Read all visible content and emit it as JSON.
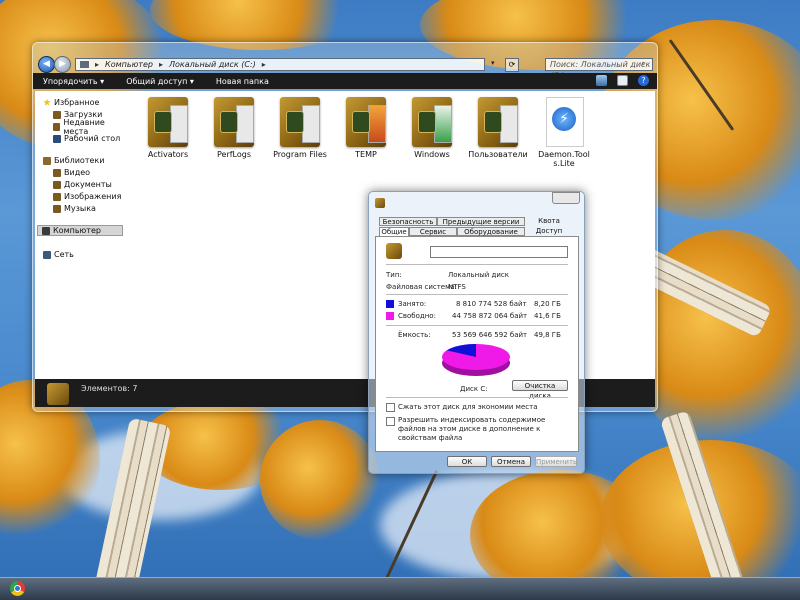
{
  "explorer": {
    "address_path": [
      "Компьютер",
      "Локальный диск (C:)"
    ],
    "search_placeholder": "Поиск: Локальный диск (C:)",
    "toolbar": {
      "organize": "Упорядочить",
      "share": "Общий доступ",
      "new_folder": "Новая папка"
    },
    "sidebar": {
      "favorites": "Избранное",
      "downloads": "Загрузки",
      "recent": "Недавние места",
      "desktop": "Рабочий стол",
      "libraries": "Библиотеки",
      "video": "Видео",
      "documents": "Документы",
      "pictures": "Изображения",
      "music": "Музыка",
      "computer": "Компьютер",
      "network": "Сеть"
    },
    "items": [
      {
        "name": "Activators"
      },
      {
        "name": "PerfLogs"
      },
      {
        "name": "Program Files"
      },
      {
        "name": "TEMP"
      },
      {
        "name": "Windows"
      },
      {
        "name": "Пользователи"
      },
      {
        "name": "Daemon.Tools.Lite"
      }
    ],
    "status": "Элементов: 7"
  },
  "dialog": {
    "tabs_row1": [
      "Безопасность",
      "Предыдущие версии",
      "Квота"
    ],
    "tabs_row2": [
      "Общие",
      "Сервис",
      "Оборудование",
      "Доступ"
    ],
    "name_value": "",
    "type_label": "Тип:",
    "type_value": "Локальный диск",
    "fs_label": "Файловая система:",
    "fs_value": "NTFS",
    "used_label": "Занято:",
    "used_bytes": "8 810 774 528 байт",
    "used_gb": "8,20 ГБ",
    "free_label": "Свободно:",
    "free_bytes": "44 758 872 064 байт",
    "free_gb": "41,6 ГБ",
    "capacity_label": "Ёмкость:",
    "capacity_bytes": "53 569 646 592 байт",
    "capacity_gb": "49,8 ГБ",
    "disk_label": "Диск C:",
    "cleanup_button": "Очистка диска",
    "compress_label": "Сжать этот диск для экономии места",
    "index_label": "Разрешить индексировать содержимое файлов на этом диске в дополнение к свойствам файла",
    "ok": "ОК",
    "cancel": "Отмена",
    "apply": "Применить",
    "used_color": "#1010d8",
    "free_color": "#f01ae8",
    "used_fraction": 0.1645
  }
}
